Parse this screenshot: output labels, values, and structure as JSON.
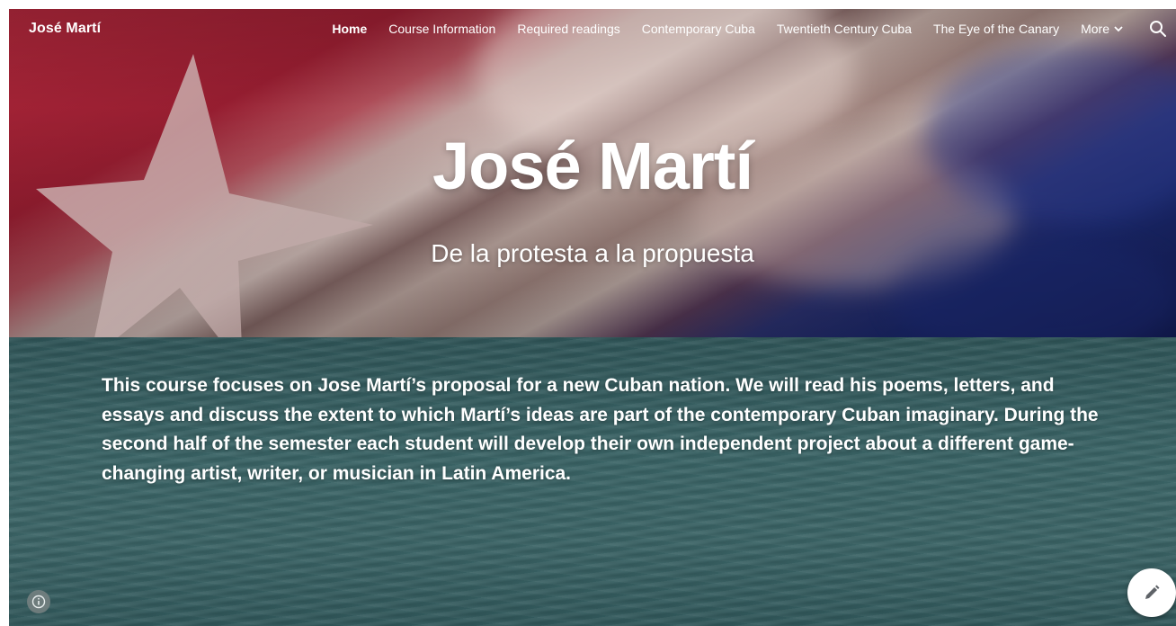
{
  "site": {
    "brand": "José Martí"
  },
  "nav": {
    "items": [
      {
        "label": "Home",
        "active": true
      },
      {
        "label": "Course Information",
        "active": false
      },
      {
        "label": "Required readings",
        "active": false
      },
      {
        "label": "Contemporary Cuba",
        "active": false
      },
      {
        "label": "Twentieth Century Cuba",
        "active": false
      },
      {
        "label": "The Eye of the Canary",
        "active": false
      }
    ],
    "more_label": "More",
    "search_icon": "search-icon"
  },
  "hero": {
    "title": "José Martí",
    "subtitle": "De la protesta a la propuesta"
  },
  "content": {
    "paragraph": "This course focuses on Jose Martí’s proposal for a new Cuban nation. We will read his poems, letters, and essays and discuss the extent to which Martí’s  ideas are part of the contemporary Cuban imaginary. During the second half of the semester  each student will develop their own independent project about a different game-changing artist, writer, or musician in Latin America."
  },
  "controls": {
    "info_icon": "info-icon",
    "edit_icon": "pencil-icon"
  },
  "colors": {
    "flag_red": "#b3283c",
    "flag_blue": "#1c2a72",
    "water": "#3a6466",
    "text": "#ffffff"
  }
}
